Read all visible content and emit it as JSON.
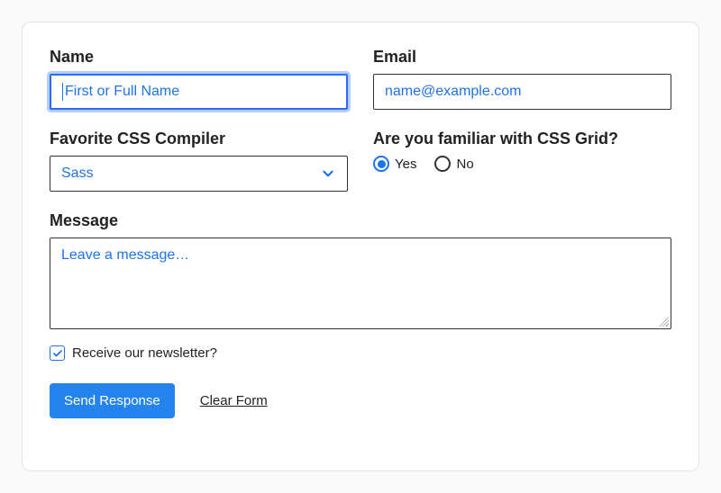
{
  "form": {
    "name": {
      "label": "Name",
      "placeholder": "First or Full Name",
      "value": ""
    },
    "email": {
      "label": "Email",
      "placeholder": "name@example.com",
      "value": ""
    },
    "compiler": {
      "label": "Favorite CSS Compiler",
      "selected": "Sass"
    },
    "grid": {
      "label": "Are you familiar with CSS Grid?",
      "options": {
        "yes": "Yes",
        "no": "No"
      },
      "value": "yes"
    },
    "message": {
      "label": "Message",
      "placeholder": "Leave a message…",
      "value": ""
    },
    "newsletter": {
      "label": "Receive our newsletter?",
      "checked": true
    },
    "actions": {
      "submit": "Send Response",
      "reset": "Clear Form"
    }
  }
}
